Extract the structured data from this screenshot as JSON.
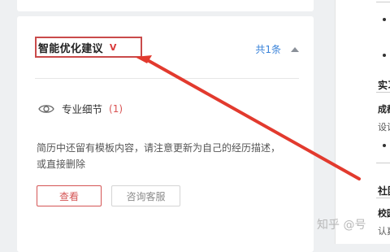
{
  "suggestions": {
    "title": "智能优化建议",
    "title_badge": "V",
    "count_text": "共1条",
    "group": {
      "label": "专业细节",
      "count": "(1)"
    },
    "description": "简历中还留有模板内容，请注意更新为自己的经历描述，或直接删除",
    "view_button": "查看",
    "consult_button": "咨询客服"
  },
  "resume_preview": {
    "section_1": "实习",
    "line_1": "成都",
    "line_2": "设计",
    "section_2": "社团",
    "line_3": "校园",
    "line_4": "认真"
  },
  "watermark": "知乎 @号",
  "colors": {
    "accent_red": "#d45555",
    "link_blue": "#3a83d9",
    "annotation_red": "#e23a2e"
  }
}
